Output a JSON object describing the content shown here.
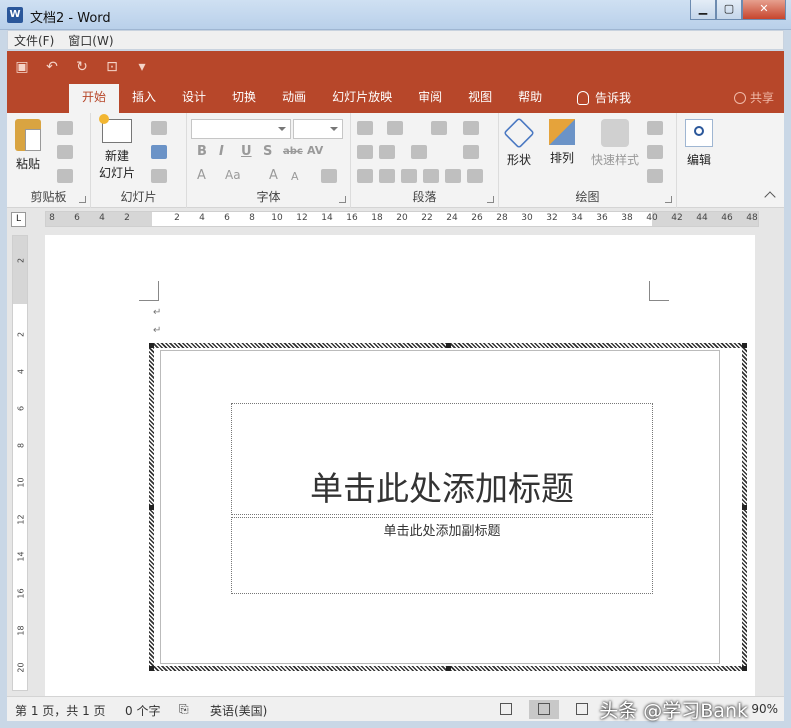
{
  "window": {
    "title": "文档2 - Word",
    "app_icon_letter": "W",
    "min": "▁",
    "max": "▢",
    "close": "✕"
  },
  "menubar": [
    "文件(F)",
    "窗口(W)"
  ],
  "ribbon": {
    "tabs": [
      "开始",
      "插入",
      "设计",
      "切换",
      "动画",
      "幻灯片放映",
      "审阅",
      "视图",
      "帮助"
    ],
    "active_tab": "开始",
    "tell_me": "告诉我",
    "share": "共享",
    "groups": {
      "clipboard": {
        "label": "剪贴板",
        "paste": "粘贴"
      },
      "slides": {
        "label": "幻灯片",
        "new_slide": "新建",
        "new_slide_2": "幻灯片"
      },
      "font": {
        "label": "字体",
        "bold": "B",
        "italic": "I",
        "underline": "U",
        "strike": "S",
        "abc": "abc",
        "av": "AV",
        "font_color": "A",
        "aa": "Aa",
        "grow": "A",
        "shrink": "A"
      },
      "paragraph": {
        "label": "段落"
      },
      "drawing": {
        "label": "绘图",
        "shapes": "形状",
        "arrange": "排列",
        "quick_styles": "快速样式"
      },
      "editing": {
        "label": "编辑"
      }
    }
  },
  "ruler": {
    "corner": "L",
    "ticks": [
      "8",
      "6",
      "4",
      "2",
      "",
      "2",
      "4",
      "6",
      "8",
      "10",
      "12",
      "14",
      "16",
      "18",
      "20",
      "22",
      "24",
      "26",
      "28",
      "30",
      "32",
      "34",
      "36",
      "38",
      "40",
      "42",
      "44",
      "46",
      "48"
    ],
    "vticks": [
      "2",
      "",
      "2",
      "4",
      "6",
      "8",
      "10",
      "12",
      "14",
      "16",
      "18",
      "20"
    ]
  },
  "document": {
    "para_marks": [
      "↵",
      "↵"
    ],
    "slide": {
      "title_placeholder": "单击此处添加标题",
      "subtitle_placeholder": "单击此处添加副标题"
    }
  },
  "statusbar": {
    "page": "第 1 页，共 1 页",
    "words": "0 个字",
    "language": "英语(美国)",
    "zoom": "90%",
    "watermark": "头条 @学习Bank"
  },
  "colors": {
    "accent": "#b7472a",
    "ribbon_bg": "#f3f3f3",
    "canvas_bg": "#e6e6e6"
  }
}
